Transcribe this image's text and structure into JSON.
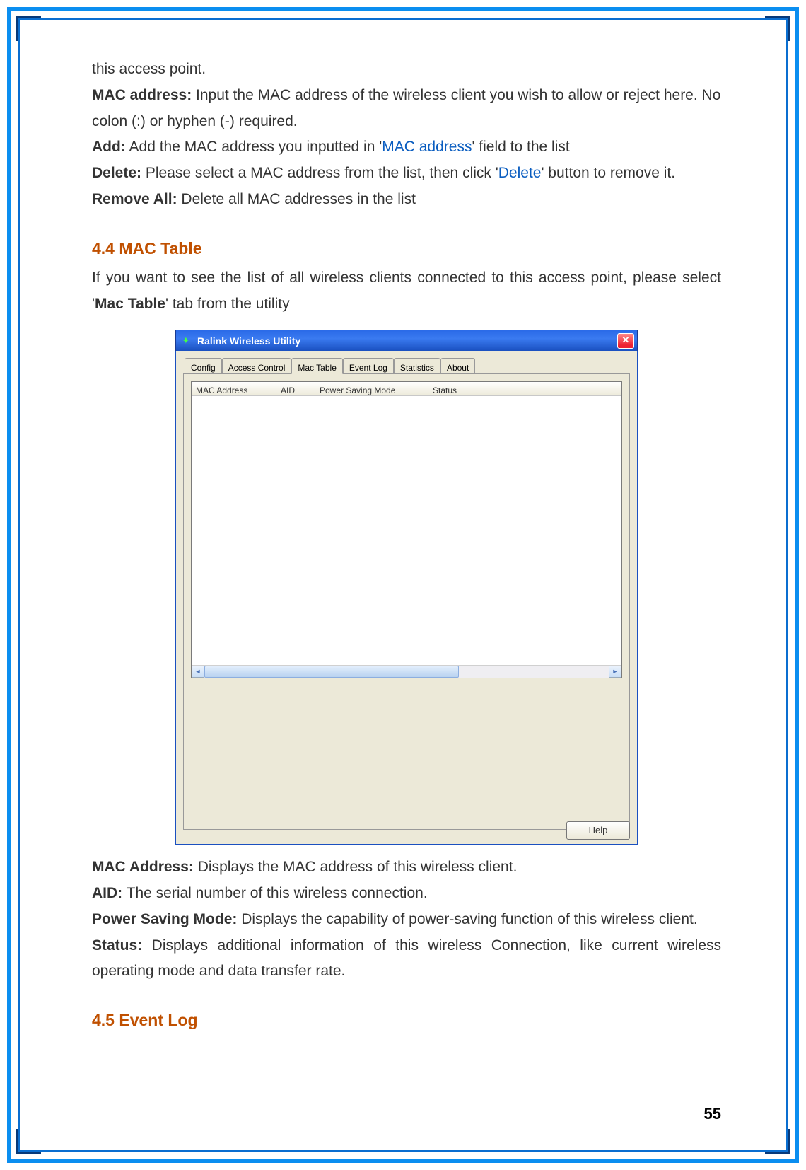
{
  "page_number": "55",
  "intro": {
    "line0": "this   access point.",
    "mac_label": "MAC address:",
    "mac_text": " Input the MAC address of the wireless client you wish to allow or reject here. No colon (:) or hyphen (-) required.",
    "add_label": "Add:",
    "add_text1": " Add the MAC address you inputted in '",
    "add_link": "MAC address",
    "add_text2": "' field to the list",
    "del_label": "Delete:",
    "del_text1": " Please select a MAC address from the list, then click '",
    "del_link": "Delete",
    "del_text2": "' button to remove it.",
    "rem_label": "Remove All:",
    "rem_text": " Delete all MAC addresses in the list"
  },
  "section44": {
    "heading": "4.4 MAC Table",
    "para1": "If you want to see the list of all wireless clients connected to this access point, please select '",
    "para1_bold": "Mac Table",
    "para1_end": "' tab from the utility"
  },
  "dialog": {
    "title": "Ralink Wireless Utility",
    "tabs": [
      "Config",
      "Access Control",
      "Mac Table",
      "Event Log",
      "Statistics",
      "About"
    ],
    "active_tab_index": 2,
    "columns": [
      "MAC Address",
      "AID",
      "Power Saving Mode",
      "Status"
    ],
    "help_button": "Help"
  },
  "desc": {
    "mac_label": "MAC Address:",
    "mac_text": " Displays the MAC address of this wireless client.",
    "aid_label": "AID:",
    "aid_text": " The serial number of this wireless connection.",
    "psm_label": "Power Saving Mode:",
    "psm_text": " Displays the capability of power-saving function of this wireless client.",
    "status_label": "Status:",
    "status_text": " Displays additional information of this wireless Connection, like current wireless operating mode and data transfer rate."
  },
  "section45": {
    "heading": "4.5 Event Log"
  }
}
